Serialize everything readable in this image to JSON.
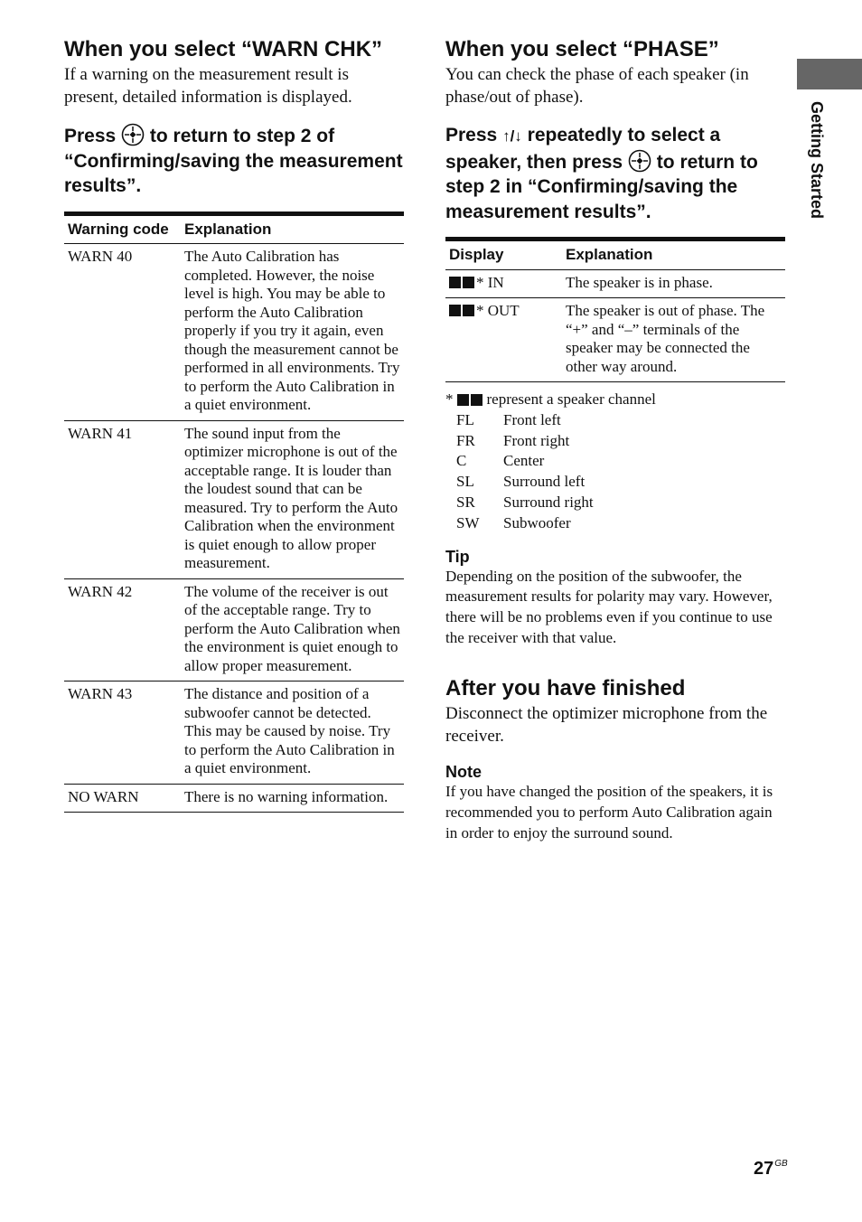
{
  "side_tab": {
    "label": "Getting Started",
    "tab_color": "#666666"
  },
  "page_number": {
    "number": "27",
    "suffix": "GB"
  },
  "warn_chk": {
    "heading": "When you select “WARN CHK”",
    "intro": "If a warning on the measurement result is present, detailed information is displayed.",
    "step_prefix": "Press",
    "step_icon": "enter-button-icon",
    "step_suffix": "to return to step 2 of “Confirming/saving the measurement results”.",
    "table": {
      "headers": [
        "Warning code",
        "Explanation"
      ],
      "rows": [
        {
          "code": "WARN 40",
          "explanation": "The Auto Calibration has completed. However, the noise level is high. You may be able to perform the Auto Calibration properly if you try it again, even though the measurement cannot be performed in all environments. Try to perform the Auto Calibration in a quiet environment."
        },
        {
          "code": "WARN 41",
          "explanation": "The sound input from the optimizer microphone is out of the acceptable range. It is louder than the loudest sound that can be measured. Try to perform the Auto Calibration when the environment is quiet enough to allow proper measurement."
        },
        {
          "code": "WARN 42",
          "explanation": "The volume of the receiver is out of the acceptable range. Try to perform the Auto Calibration when the environment is quiet enough to allow proper measurement."
        },
        {
          "code": "WARN 43",
          "explanation": "The distance and position of a subwoofer cannot be detected. This may be caused by noise. Try to perform the Auto Calibration in a quiet environment."
        },
        {
          "code": "NO WARN",
          "explanation": "There is no warning information."
        }
      ]
    }
  },
  "phase": {
    "heading": "When you select “PHASE”",
    "intro": "You can check the phase of each speaker (in phase/out of phase).",
    "step_prefix": "Press",
    "step_arrows": "↑/↓",
    "step_middle": "repeatedly to select a speaker, then press",
    "step_suffix": "to return to step 2 in “Confirming/saving the measurement results”.",
    "table": {
      "headers": [
        "Display",
        "Explanation"
      ],
      "rows": [
        {
          "display": "* IN",
          "explanation": "The speaker is in phase."
        },
        {
          "display": "* OUT",
          "explanation": "The speaker is out of phase. The “+” and “–” terminals of the speaker may be connected the other way around."
        }
      ]
    },
    "footnote": {
      "marker": "*",
      "text": "represent a speaker channel",
      "channels": [
        {
          "code": "FL",
          "name": "Front left"
        },
        {
          "code": "FR",
          "name": "Front right"
        },
        {
          "code": "C",
          "name": "Center"
        },
        {
          "code": "SL",
          "name": "Surround left"
        },
        {
          "code": "SR",
          "name": "Surround right"
        },
        {
          "code": "SW",
          "name": "Subwoofer"
        }
      ]
    }
  },
  "tip": {
    "heading": "Tip",
    "text": "Depending on the position of the subwoofer, the measurement results for polarity may vary. However, there will be no problems even if you continue to use the receiver with that value."
  },
  "after": {
    "heading": "After you have finished",
    "text": "Disconnect the optimizer microphone from the receiver."
  },
  "note": {
    "heading": "Note",
    "text": "If you have changed the position of the speakers, it is recommended you to perform Auto Calibration again in order to enjoy the surround sound."
  }
}
